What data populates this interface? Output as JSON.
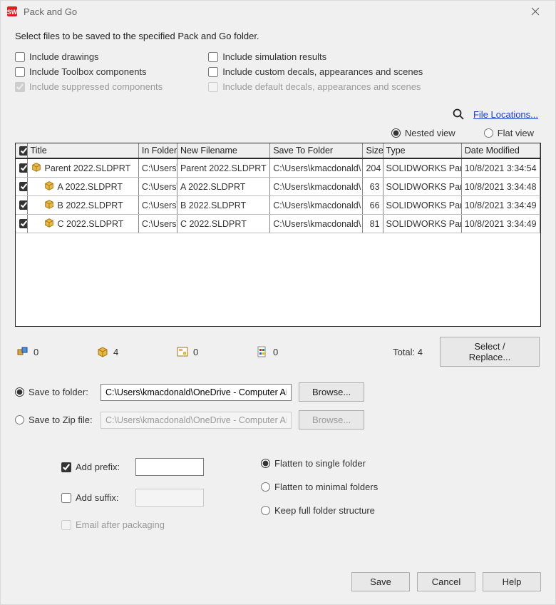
{
  "window": {
    "title": "Pack and Go"
  },
  "subtitle": "Select files to be saved to the specified Pack and Go folder.",
  "options": {
    "include_drawings": "Include drawings",
    "include_toolbox": "Include Toolbox components",
    "include_suppressed": "Include suppressed components",
    "include_simulation": "Include simulation results",
    "include_custom_decals": "Include custom decals, appearances and scenes",
    "include_default_decals": "Include default decals, appearances and scenes"
  },
  "file_locations": "File Locations...",
  "views": {
    "nested": "Nested view",
    "flat": "Flat view"
  },
  "table": {
    "headers": {
      "title": "Title",
      "in_folder": "In Folder",
      "new_filename": "New Filename",
      "save_to": "Save To Folder",
      "size": "Size",
      "type": "Type",
      "date": "Date Modified"
    },
    "rows": [
      {
        "title": "Parent 2022.SLDPRT",
        "in_folder": "C:\\Users\\",
        "new_filename": "Parent 2022.SLDPRT",
        "save_to": "C:\\Users\\kmacdonald\\",
        "size": "204",
        "type": "SOLIDWORKS Part",
        "date": "10/8/2021 3:34:54",
        "indent": 0
      },
      {
        "title": "A 2022.SLDPRT",
        "in_folder": "C:\\Users\\",
        "new_filename": "A 2022.SLDPRT",
        "save_to": "C:\\Users\\kmacdonald\\",
        "size": "63",
        "type": "SOLIDWORKS Part",
        "date": "10/8/2021 3:34:48",
        "indent": 1
      },
      {
        "title": "B 2022.SLDPRT",
        "in_folder": "C:\\Users\\",
        "new_filename": "B 2022.SLDPRT",
        "save_to": "C:\\Users\\kmacdonald\\",
        "size": "66",
        "type": "SOLIDWORKS Part",
        "date": "10/8/2021 3:34:49",
        "indent": 1
      },
      {
        "title": "C 2022.SLDPRT",
        "in_folder": "C:\\Users\\",
        "new_filename": "C 2022.SLDPRT",
        "save_to": "C:\\Users\\kmacdonald\\",
        "size": "81",
        "type": "SOLIDWORKS Part",
        "date": "10/8/2021 3:34:49",
        "indent": 1
      }
    ]
  },
  "summary": {
    "assemblies": "0",
    "parts": "4",
    "drawings": "0",
    "other": "0",
    "total_label": "Total:",
    "total": "4",
    "select_replace": "Select / Replace..."
  },
  "save": {
    "folder_label": "Save to folder:",
    "folder_path": "C:\\Users\\kmacdonald\\OneDrive - Computer Ai",
    "zip_label": "Save to Zip file:",
    "zip_path": "C:\\Users\\kmacdonald\\OneDrive - Computer Ai",
    "browse": "Browse..."
  },
  "affix": {
    "prefix_label": "Add prefix:",
    "suffix_label": "Add suffix:",
    "email_label": "Email after packaging"
  },
  "folder_opts": {
    "flatten_single": "Flatten to single folder",
    "flatten_minimal": "Flatten to minimal folders",
    "keep_full": "Keep full folder structure"
  },
  "buttons": {
    "save": "Save",
    "cancel": "Cancel",
    "help": "Help"
  }
}
